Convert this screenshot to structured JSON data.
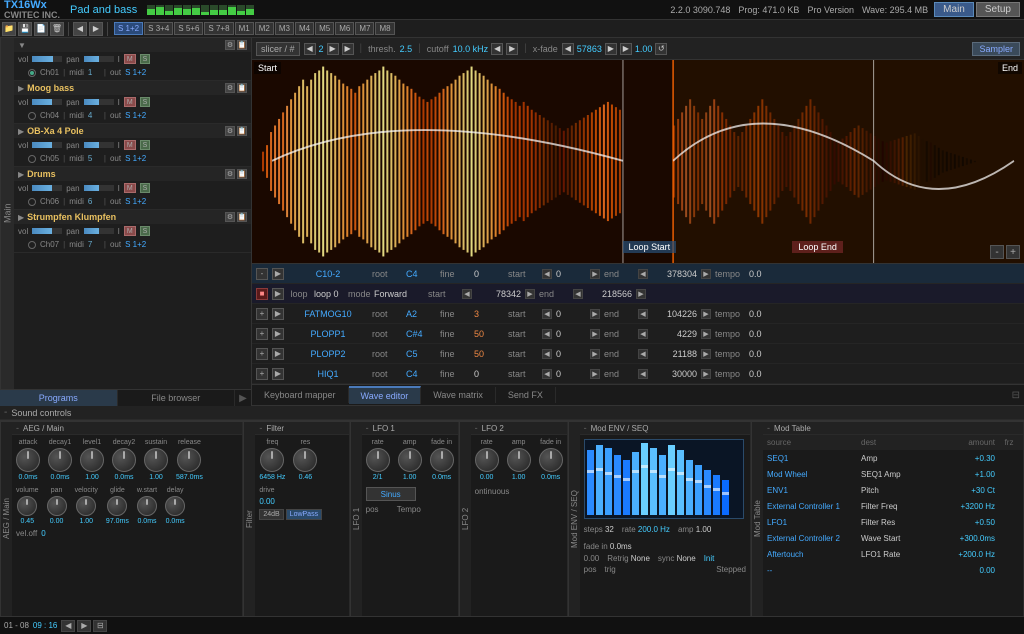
{
  "app": {
    "title": "TX16Wx",
    "company": "CWITEC INC.",
    "version": "2.2.0 3090.748",
    "prog_size": "Prog: 471.0 KB",
    "wave_size": "Wave: 295.4 MB",
    "preset": "Pad and bass",
    "pro_version": "Pro Version"
  },
  "toolbar": {
    "routes": [
      "S 1+2",
      "S 3+4",
      "S 5+6",
      "S 7+8",
      "M1",
      "M2",
      "M3",
      "M4",
      "M5",
      "M6",
      "M7",
      "M8"
    ]
  },
  "instruments": [
    {
      "name": "Ch01",
      "group": "  ",
      "midi": "midi",
      "midi_ch": "1",
      "out": "S 1+2",
      "vol": 70,
      "pan": 50
    },
    {
      "name": "Moog bass",
      "ch": "Ch04",
      "midi": "midi",
      "midi_ch": "4",
      "out": "S 1+2",
      "vol": 65,
      "pan": 50
    },
    {
      "name": "OB-Xa 4 Pole",
      "ch": "Ch05",
      "midi": "midi",
      "midi_ch": "5",
      "out": "S 1+2",
      "vol": 65,
      "pan": 50
    },
    {
      "name": "Drums",
      "ch": "Ch06",
      "midi": "midi",
      "midi_ch": "6",
      "out": "S 1+2",
      "vol": 65,
      "pan": 50
    },
    {
      "name": "Strumpfen Klumpfen",
      "ch": "Ch07",
      "midi": "midi",
      "midi_ch": "7",
      "out": "S 1+2",
      "vol": 65,
      "pan": 50
    }
  ],
  "left_tabs": [
    "Programs",
    "File browser"
  ],
  "wave_editor": {
    "slicer_label": "slicer / #",
    "slicer_val": "2",
    "thresh_label": "thresh.",
    "thresh_val": "2.5",
    "cutoff_label": "cutoff",
    "cutoff_val": "10.0 kHz",
    "xfade_label": "x-fade",
    "xfade_val": "57863",
    "vol_val": "1.00",
    "sampler_btn": "Sampler",
    "start_label": "Start",
    "end_label": "End",
    "loop_start": "Loop Start",
    "loop_end": "Loop End"
  },
  "slices": [
    {
      "name": "C10-2",
      "root": "C4",
      "fine": "0",
      "start_val": "0",
      "end_val": "378304",
      "tempo": "0.0",
      "is_active": true
    },
    {
      "name": "loop 0",
      "mode": "Forward",
      "start_val": "78342",
      "end_val": "218566",
      "is_loop": true
    },
    {
      "name": "FATMOG10",
      "root": "A2",
      "fine": "3",
      "start_val": "0",
      "end_val": "104226",
      "tempo": "0.0"
    },
    {
      "name": "PLOPP1",
      "root": "C#4",
      "fine": "50",
      "start_val": "0",
      "end_val": "4229",
      "tempo": "0.0"
    },
    {
      "name": "PLOPP2",
      "root": "C5",
      "fine": "50",
      "start_val": "0",
      "end_val": "21188",
      "tempo": "0.0"
    },
    {
      "name": "HIQ1",
      "root": "C4",
      "fine": "0",
      "start_val": "0",
      "end_val": "30000",
      "tempo": "0.0"
    }
  ],
  "tabs": [
    "Keyboard mapper",
    "Wave editor",
    "Wave matrix",
    "Send FX"
  ],
  "active_tab": "Wave editor",
  "sound_controls": {
    "title": "Sound controls",
    "aeg": {
      "label": "AEG / Main",
      "params": [
        {
          "name": "attack",
          "val": "0.0ms"
        },
        {
          "name": "decay1",
          "val": "0.0ms"
        },
        {
          "name": "level1",
          "val": "1.00"
        },
        {
          "name": "decay2",
          "val": "0.0ms"
        },
        {
          "name": "sustain",
          "val": "1.00"
        },
        {
          "name": "release",
          "val": "587.0ms"
        }
      ],
      "params2": [
        {
          "name": "volume",
          "val": "0.45"
        },
        {
          "name": "pan",
          "val": "0.00"
        },
        {
          "name": "velocity",
          "val": "1.00"
        },
        {
          "name": "glide",
          "val": "97.0ms"
        },
        {
          "name": "w.start",
          "val": "0.0ms"
        },
        {
          "name": "delay",
          "val": "0.0ms"
        }
      ],
      "vel_off": "0"
    },
    "filter": {
      "label": "Filter",
      "freq": "6458 Hz",
      "res": "0.46",
      "drive": "0.00",
      "db": "24dB",
      "mode": "LowPass"
    },
    "lfo1": {
      "label": "LFO 1",
      "rate": "2/1",
      "amp": "1.00",
      "fade_in": "0.0ms",
      "wave": "Sinus",
      "pos": "pos",
      "tempo": "Tempo"
    },
    "lfo2": {
      "label": "LFO 2",
      "rate": "0.00",
      "mode": "ontinuous"
    },
    "mod_env": {
      "label": "Mod ENV / SEQ",
      "steps": "32",
      "rate": "200.0 Hz",
      "amp": "1.00",
      "fade_in": "0.0ms",
      "retrig": "None",
      "sync": "None",
      "pos": "pos",
      "trig": "trig",
      "init": "Init",
      "stepped": "Stepped"
    },
    "mod_table": {
      "label": "Mod Table",
      "rows": [
        {
          "src": "SEQ1",
          "dest": "Amp",
          "amt": "+0.30",
          "frz": ""
        },
        {
          "src": "Mod Wheel",
          "dest": "SEQ1 Amp",
          "amt": "+1.00",
          "frz": ""
        },
        {
          "src": "ENV1",
          "dest": "Pitch",
          "amt": "+30 Ct",
          "frz": ""
        },
        {
          "src": "External Controller 1",
          "dest": "Filter Freq",
          "amt": "+3200 Hz",
          "frz": ""
        },
        {
          "src": "LFO1",
          "dest": "Filter Res",
          "amt": "+0.50",
          "frz": ""
        },
        {
          "src": "External Controller 2",
          "dest": "Wave Start",
          "amt": "+300.0ms",
          "frz": ""
        },
        {
          "src": "Aftertouch",
          "dest": "LFO1 Rate",
          "amt": "+200.0 Hz",
          "frz": ""
        },
        {
          "src": "--",
          "dest": "",
          "amt": "0.00",
          "frz": ""
        }
      ]
    }
  },
  "bottom_bar": {
    "range": "01 - 08",
    "time": "09 : 16"
  }
}
